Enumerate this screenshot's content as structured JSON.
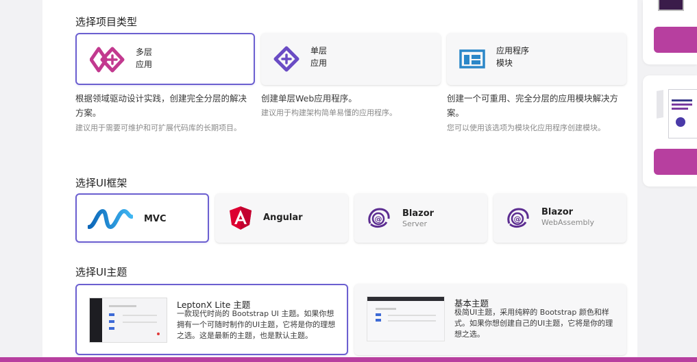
{
  "project_type": {
    "title": "选择项目类型",
    "options": [
      {
        "line1": "多层",
        "line2": "应用",
        "desc": "根据领域驱动设计实践，创建完全分层的解决方案。",
        "sub": "建议用于需要可维护和可扩展代码库的长期项目。",
        "selected": true,
        "icon": "layered-app-icon"
      },
      {
        "line1": "单层",
        "line2": "应用",
        "desc": "创建单层Web应用程序。",
        "sub": "建议用于构建架构简单易懂的应用程序。",
        "selected": false,
        "icon": "single-layer-icon"
      },
      {
        "line1": "应用程序",
        "line2": "模块",
        "desc": "创建一个可重用、完全分层的应用模块解决方案。",
        "sub": "您可以使用该选项为模块化应用程序创建模块。",
        "selected": false,
        "icon": "module-icon"
      }
    ]
  },
  "ui_framework": {
    "title": "选择UI框架",
    "options": [
      {
        "name": "MVC",
        "sub": "",
        "selected": true,
        "icon": "dotnet-mvc-icon"
      },
      {
        "name": "Angular",
        "sub": "",
        "selected": false,
        "icon": "angular-icon"
      },
      {
        "name": "Blazor",
        "sub": "Server",
        "selected": false,
        "icon": "blazor-icon"
      },
      {
        "name": "Blazor",
        "sub": "WebAssembly",
        "selected": false,
        "icon": "blazor-icon"
      }
    ]
  },
  "ui_theme": {
    "title": "选择UI主题",
    "options": [
      {
        "name": "LeptonX Lite 主题",
        "desc": "一款现代时尚的 Bootstrap UI 主题。如果你想拥有一个可随时制作的UI主题，它将是你的理想之选。这是最新的主题，也是默认主题。",
        "selected": true,
        "icon": "leptonx-preview-thumbnail"
      },
      {
        "name": "基本主题",
        "desc": "极简UI主题，采用纯粹的 Bootstrap 颜色和样式。如果你想创建自己的UI主题，它将是你的理想之选。",
        "selected": false,
        "icon": "basic-theme-preview-thumbnail"
      }
    ]
  },
  "colors": {
    "accent_border": "#6b5fd0",
    "brand_magenta": "#b73f9f"
  }
}
